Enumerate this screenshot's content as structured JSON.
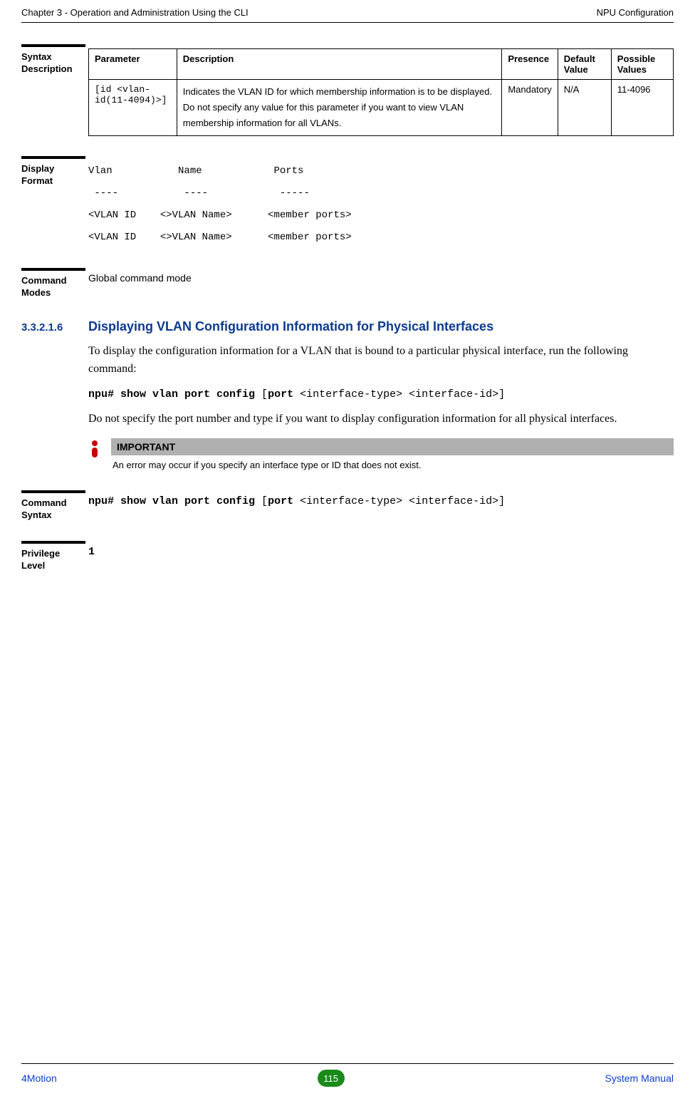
{
  "header": {
    "left": "Chapter 3 - Operation and Administration Using the CLI",
    "right": "NPU Configuration"
  },
  "syntax_desc": {
    "label_l1": "Syntax",
    "label_l2": "Description",
    "cols": {
      "parameter": "Parameter",
      "description": "Description",
      "presence": "Presence",
      "default": "Default Value",
      "possible": "Possible Values"
    },
    "row": {
      "parameter": "[id <vlan-id(11-4094)>]",
      "description": "Indicates the VLAN ID for which membership information is to be displayed. Do not specify any value for this parameter if you want to view VLAN membership information for all VLANs.",
      "presence": "Mandatory",
      "default": "N/A",
      "possible": "11-4096"
    }
  },
  "display_format": {
    "label_l1": "Display",
    "label_l2": "Format",
    "text": "Vlan           Name            Ports\n ----           ----            -----\n<VLAN ID    <>VLAN Name>      <member ports>\n<VLAN ID    <>VLAN Name>      <member ports>"
  },
  "command_modes": {
    "label_l1": "Command",
    "label_l2": "Modes",
    "value": "Global command mode"
  },
  "heading": {
    "num": "3.3.2.1.6",
    "text": "Displaying VLAN Configuration Information for Physical Interfaces"
  },
  "para1": "To display the configuration information for a VLAN that is bound to a particular physical interface, run the following command:",
  "cmd1_bold1": "npu# show vlan port config",
  "cmd1_plain1": " [",
  "cmd1_bold2": "port",
  "cmd1_plain2": " <interface-type> <interface-id>]",
  "para2": "Do not specify the port number and type if you want to display configuration information for all physical interfaces.",
  "important": {
    "title": "IMPORTANT",
    "note": "An error may occur if you specify an interface type or ID that does not exist."
  },
  "command_syntax": {
    "label_l1": "Command",
    "label_l2": "Syntax",
    "bold1": "npu# show vlan port config",
    "plain1": " [",
    "bold2": "port",
    "plain2": " <interface-type> <interface-id>]"
  },
  "privilege": {
    "label_l1": "Privilege",
    "label_l2": "Level",
    "value": "1"
  },
  "footer": {
    "left": "4Motion",
    "center": "115",
    "right": "System Manual"
  }
}
